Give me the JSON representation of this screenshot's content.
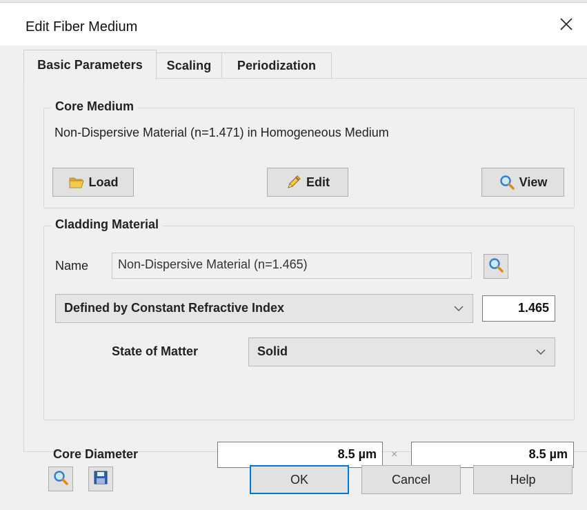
{
  "window": {
    "title": "Edit Fiber Medium",
    "close_icon": "close-icon"
  },
  "tabs": [
    {
      "label": "Basic Parameters",
      "active": true
    },
    {
      "label": "Scaling",
      "active": false
    },
    {
      "label": "Periodization",
      "active": false
    }
  ],
  "core_medium": {
    "group_title": "Core Medium",
    "description": "Non-Dispersive Material (n=1.471) in Homogeneous Medium",
    "load_label": "Load",
    "edit_label": "Edit",
    "view_label": "View"
  },
  "cladding": {
    "group_title": "Cladding Material",
    "name_label": "Name",
    "name_value": "Non-Dispersive Material (n=1.465)",
    "definition_selected": "Defined by Constant Refractive Index",
    "refractive_index": "1.465",
    "state_label": "State of Matter",
    "state_selected": "Solid"
  },
  "core_diameter": {
    "label": "Core Diameter",
    "x_value": "8.5 µm",
    "times_sign": "×",
    "y_value": "8.5 µm"
  },
  "footer": {
    "ok_label": "OK",
    "cancel_label": "Cancel",
    "help_label": "Help"
  },
  "colors": {
    "accent": "#0078d7",
    "dialog_bg": "#f0f0f0",
    "folder_yellow": "#f2c94c",
    "magnifier_blue": "#2f7fd1"
  }
}
